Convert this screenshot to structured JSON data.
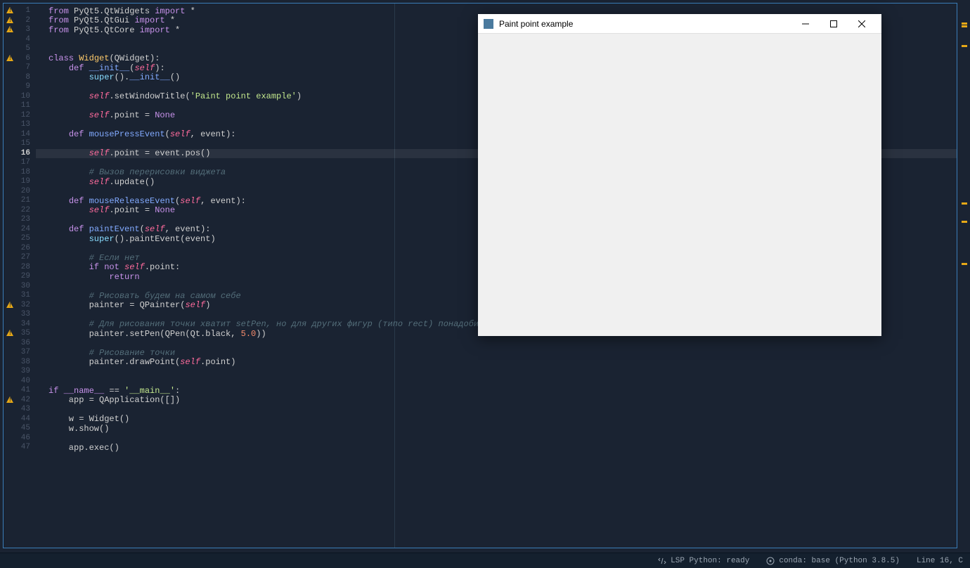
{
  "editor": {
    "current_line": 16,
    "warning_lines": [
      1,
      2,
      3,
      6,
      32,
      35,
      42
    ],
    "eol_marker_line": 40,
    "lines": [
      {
        "n": 1,
        "t": [
          [
            "kw",
            "from"
          ],
          [
            "nn",
            " PyQt5.QtWidgets "
          ],
          [
            "kw",
            "import"
          ],
          [
            "nn",
            " *"
          ]
        ]
      },
      {
        "n": 2,
        "t": [
          [
            "kw",
            "from"
          ],
          [
            "nn",
            " PyQt5.QtGui "
          ],
          [
            "kw",
            "import"
          ],
          [
            "nn",
            " *"
          ]
        ]
      },
      {
        "n": 3,
        "t": [
          [
            "kw",
            "from"
          ],
          [
            "nn",
            " PyQt5.QtCore "
          ],
          [
            "kw",
            "import"
          ],
          [
            "nn",
            " *"
          ]
        ]
      },
      {
        "n": 4,
        "t": []
      },
      {
        "n": 5,
        "t": []
      },
      {
        "n": 6,
        "t": [
          [
            "kw",
            "class"
          ],
          [
            "nn",
            " "
          ],
          [
            "cls",
            "Widget"
          ],
          [
            "nn",
            "(QWidget):"
          ]
        ]
      },
      {
        "n": 7,
        "t": [
          [
            "nn",
            "    "
          ],
          [
            "kw",
            "def"
          ],
          [
            "nn",
            " "
          ],
          [
            "fn",
            "__init__"
          ],
          [
            "nn",
            "("
          ],
          [
            "slf",
            "self"
          ],
          [
            "nn",
            "):"
          ]
        ]
      },
      {
        "n": 8,
        "t": [
          [
            "nn",
            "        "
          ],
          [
            "bi",
            "super"
          ],
          [
            "nn",
            "()."
          ],
          [
            "fn",
            "__init__"
          ],
          [
            "nn",
            "()"
          ]
        ]
      },
      {
        "n": 9,
        "t": []
      },
      {
        "n": 10,
        "t": [
          [
            "nn",
            "        "
          ],
          [
            "slf",
            "self"
          ],
          [
            "nn",
            ".setWindowTitle("
          ],
          [
            "str",
            "'Paint point example'"
          ],
          [
            "nn",
            ")"
          ]
        ]
      },
      {
        "n": 11,
        "t": []
      },
      {
        "n": 12,
        "t": [
          [
            "nn",
            "        "
          ],
          [
            "slf",
            "self"
          ],
          [
            "nn",
            ".point = "
          ],
          [
            "kw",
            "None"
          ]
        ]
      },
      {
        "n": 13,
        "t": []
      },
      {
        "n": 14,
        "t": [
          [
            "nn",
            "    "
          ],
          [
            "kw",
            "def"
          ],
          [
            "nn",
            " "
          ],
          [
            "fn",
            "mousePressEvent"
          ],
          [
            "nn",
            "("
          ],
          [
            "slf",
            "self"
          ],
          [
            "nn",
            ", event):"
          ]
        ]
      },
      {
        "n": 15,
        "t": []
      },
      {
        "n": 16,
        "t": [
          [
            "nn",
            "        "
          ],
          [
            "slf",
            "self"
          ],
          [
            "nn",
            ".point = event.pos()"
          ]
        ]
      },
      {
        "n": 17,
        "t": []
      },
      {
        "n": 18,
        "t": [
          [
            "nn",
            "        "
          ],
          [
            "cmt",
            "# Вызов перерисовки виджета"
          ]
        ]
      },
      {
        "n": 19,
        "t": [
          [
            "nn",
            "        "
          ],
          [
            "slf",
            "self"
          ],
          [
            "nn",
            ".update()"
          ]
        ]
      },
      {
        "n": 20,
        "t": []
      },
      {
        "n": 21,
        "t": [
          [
            "nn",
            "    "
          ],
          [
            "kw",
            "def"
          ],
          [
            "nn",
            " "
          ],
          [
            "fn",
            "mouseReleaseEvent"
          ],
          [
            "nn",
            "("
          ],
          [
            "slf",
            "self"
          ],
          [
            "nn",
            ", event):"
          ]
        ]
      },
      {
        "n": 22,
        "t": [
          [
            "nn",
            "        "
          ],
          [
            "slf",
            "self"
          ],
          [
            "nn",
            ".point = "
          ],
          [
            "kw",
            "None"
          ]
        ]
      },
      {
        "n": 23,
        "t": []
      },
      {
        "n": 24,
        "t": [
          [
            "nn",
            "    "
          ],
          [
            "kw",
            "def"
          ],
          [
            "nn",
            " "
          ],
          [
            "fn",
            "paintEvent"
          ],
          [
            "nn",
            "("
          ],
          [
            "slf",
            "self"
          ],
          [
            "nn",
            ", event):"
          ]
        ]
      },
      {
        "n": 25,
        "t": [
          [
            "nn",
            "        "
          ],
          [
            "bi",
            "super"
          ],
          [
            "nn",
            "().paintEvent(event)"
          ]
        ]
      },
      {
        "n": 26,
        "t": []
      },
      {
        "n": 27,
        "t": [
          [
            "nn",
            "        "
          ],
          [
            "cmt",
            "# Если нет"
          ]
        ]
      },
      {
        "n": 28,
        "t": [
          [
            "nn",
            "        "
          ],
          [
            "kw",
            "if"
          ],
          [
            "nn",
            " "
          ],
          [
            "kw",
            "not"
          ],
          [
            "nn",
            " "
          ],
          [
            "slf",
            "self"
          ],
          [
            "nn",
            ".point:"
          ]
        ]
      },
      {
        "n": 29,
        "t": [
          [
            "nn",
            "            "
          ],
          [
            "kw",
            "return"
          ]
        ]
      },
      {
        "n": 30,
        "t": []
      },
      {
        "n": 31,
        "t": [
          [
            "nn",
            "        "
          ],
          [
            "cmt",
            "# Рисовать будем на самом себе"
          ]
        ]
      },
      {
        "n": 32,
        "t": [
          [
            "nn",
            "        painter = QPainter("
          ],
          [
            "slf",
            "self"
          ],
          [
            "nn",
            ")"
          ]
        ]
      },
      {
        "n": 33,
        "t": []
      },
      {
        "n": 34,
        "t": [
          [
            "nn",
            "        "
          ],
          [
            "cmt",
            "# Для рисования точки хватит setPen, но для других фигур (типо rect) понадобится setBrush"
          ]
        ]
      },
      {
        "n": 35,
        "t": [
          [
            "nn",
            "        painter.setPen(QPen(Qt.black, "
          ],
          [
            "num",
            "5.0"
          ],
          [
            "nn",
            "))"
          ]
        ]
      },
      {
        "n": 36,
        "t": []
      },
      {
        "n": 37,
        "t": [
          [
            "nn",
            "        "
          ],
          [
            "cmt",
            "# Рисование точки"
          ]
        ]
      },
      {
        "n": 38,
        "t": [
          [
            "nn",
            "        painter.drawPoint("
          ],
          [
            "slf",
            "self"
          ],
          [
            "nn",
            ".point)"
          ]
        ]
      },
      {
        "n": 39,
        "t": []
      },
      {
        "n": 40,
        "t": []
      },
      {
        "n": 41,
        "t": [
          [
            "kw",
            "if"
          ],
          [
            "nn",
            " "
          ],
          [
            "du",
            "__name__"
          ],
          [
            "nn",
            " == "
          ],
          [
            "str",
            "'__main__'"
          ],
          [
            "nn",
            ":"
          ]
        ]
      },
      {
        "n": 42,
        "t": [
          [
            "nn",
            "    app = QApplication([])"
          ]
        ]
      },
      {
        "n": 43,
        "t": []
      },
      {
        "n": 44,
        "t": [
          [
            "nn",
            "    w = Widget()"
          ]
        ]
      },
      {
        "n": 45,
        "t": [
          [
            "nn",
            "    w.show()"
          ]
        ]
      },
      {
        "n": 46,
        "t": []
      },
      {
        "n": 47,
        "t": [
          [
            "nn",
            "    app.exec()"
          ]
        ]
      }
    ]
  },
  "popup": {
    "title": "Paint point example"
  },
  "minimap_markers": [
    28,
    32,
    60,
    284,
    310,
    370
  ],
  "status": {
    "lsp": "LSP Python: ready",
    "conda": "conda: base (Python 3.8.5)",
    "line": "Line 16, C"
  }
}
